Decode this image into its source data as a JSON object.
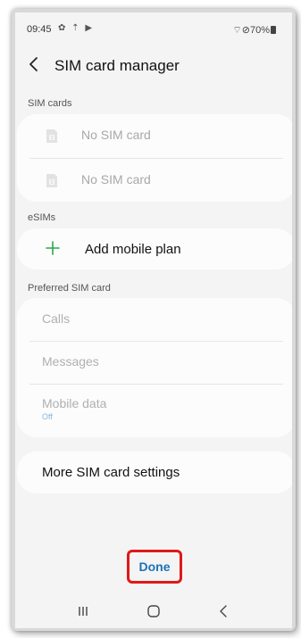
{
  "status_bar": {
    "time": "09:45",
    "left_icons": "✿ ⇡ ▶",
    "right_text": "⌔⊘70%"
  },
  "header": {
    "title": "SIM card manager"
  },
  "sim_cards": {
    "section_label": "SIM cards",
    "items": [
      {
        "label": "No SIM card",
        "icon": "sim-1-icon"
      },
      {
        "label": "No SIM card",
        "icon": "sim-2-icon"
      }
    ]
  },
  "esims": {
    "section_label": "eSIMs",
    "add_plan_label": "Add mobile plan",
    "accent_color": "#2aa84a"
  },
  "preferred": {
    "section_label": "Preferred SIM card",
    "items": [
      {
        "label": "Calls"
      },
      {
        "label": "Messages"
      },
      {
        "label": "Mobile data",
        "value": "Off"
      }
    ]
  },
  "more_settings": {
    "label": "More SIM card settings"
  },
  "footer": {
    "done_label": "Done",
    "done_color": "#1a73b8",
    "highlight_color": "#e01818"
  },
  "navbar": {
    "buttons": [
      "recents-icon",
      "home-icon",
      "back-nav-icon"
    ]
  }
}
